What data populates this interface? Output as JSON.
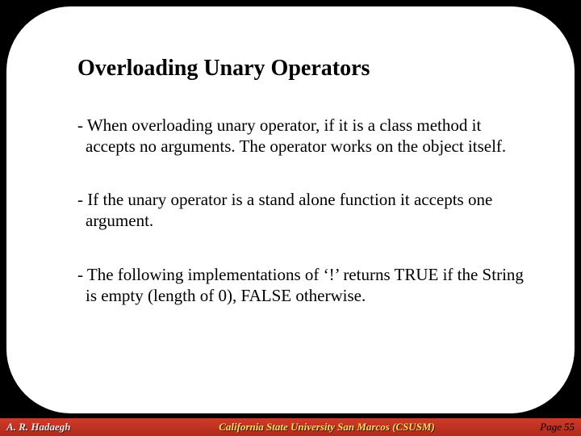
{
  "title": "Overloading Unary Operators",
  "paragraphs": {
    "p1": "- When overloading unary operator, if it is a class method it accepts no arguments. The operator works on the object itself.",
    "p2": "- If the unary operator is a stand alone function it accepts one argument.",
    "p3": "- The following implementations of ‘!’ returns TRUE if the String is empty (length of 0), FALSE otherwise."
  },
  "footer": {
    "author": "A. R. Hadaegh",
    "affiliation": "California State University San Marcos (CSUSM)",
    "page_label": "Page",
    "page_number": "55"
  }
}
